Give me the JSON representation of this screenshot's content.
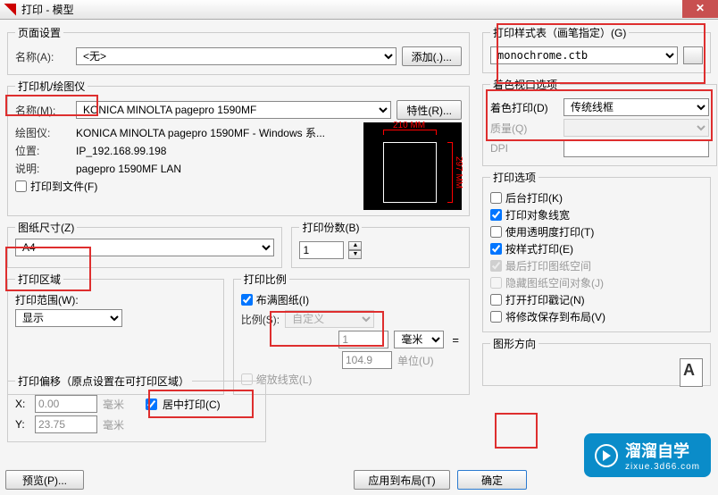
{
  "title": "打印 - 模型",
  "page_setup": {
    "legend": "页面设置",
    "name_lbl": "名称(A):",
    "name_val": "<无>",
    "add_btn": "添加(.)..."
  },
  "printer": {
    "legend": "打印机/绘图仪",
    "name_lbl": "名称(M):",
    "name_val": "KONICA MINOLTA pagepro 1590MF",
    "props_btn": "特性(R)...",
    "plotter_lbl": "绘图仪:",
    "plotter_val": "KONICA MINOLTA pagepro 1590MF - Windows 系...",
    "loc_lbl": "位置:",
    "loc_val": "IP_192.168.99.198",
    "desc_lbl": "说明:",
    "desc_val": "pagepro 1590MF LAN",
    "file_chk": "打印到文件(F)",
    "dim_w": "210 MM",
    "dim_h": "297 MM"
  },
  "paper": {
    "legend": "图纸尺寸(Z)",
    "val": "A4"
  },
  "copies": {
    "legend": "打印份数(B)",
    "val": "1"
  },
  "area": {
    "legend": "打印区域",
    "range_lbl": "打印范围(W):",
    "range_val": "显示"
  },
  "scale": {
    "legend": "打印比例",
    "fit_chk": "布满图纸(I)",
    "scale_lbl": "比例(S):",
    "scale_val": "自定义",
    "num": "1",
    "unit": "毫米",
    "denom": "104.9",
    "denom_unit": "单位(U)",
    "scale_lw": "缩放线宽(L)"
  },
  "offset": {
    "legend": "打印偏移（原点设置在可打印区域）",
    "x_lbl": "X:",
    "x_val": "0.00",
    "y_lbl": "Y:",
    "y_val": "23.75",
    "mm": "毫米",
    "center_chk": "居中打印(C)"
  },
  "style": {
    "legend": "打印样式表（画笔指定）(G)",
    "val": "monochrome.ctb"
  },
  "viewport": {
    "legend": "着色视口选项",
    "shade_lbl": "着色打印(D)",
    "shade_val": "传统线框",
    "quality_lbl": "质量(Q)",
    "dpi_lbl": "DPI"
  },
  "options": {
    "legend": "打印选项",
    "o1": "后台打印(K)",
    "o2": "打印对象线宽",
    "o3": "使用透明度打印(T)",
    "o4": "按样式打印(E)",
    "o5": "最后打印图纸空间",
    "o6": "隐藏图纸空间对象(J)",
    "o7": "打开打印戳记(N)",
    "o8": "将修改保存到布局(V)"
  },
  "orient": {
    "legend": "图形方向"
  },
  "buttons": {
    "preview": "预览(P)...",
    "apply": "应用到布局(T)",
    "ok": "确定"
  },
  "watermark": {
    "brand": "溜溜自学",
    "url": "zixue.3d66.com"
  }
}
